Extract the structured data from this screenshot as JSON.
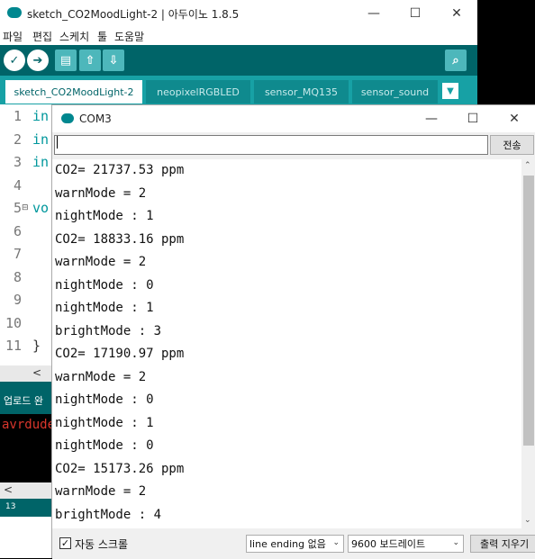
{
  "ide": {
    "title": "sketch_CO2MoodLight-2 | 아두이노 1.8.5",
    "window_controls": {
      "minimize": "—",
      "maximize": "☐",
      "close": "✕"
    },
    "menu": [
      "파일",
      "편집",
      "스케치",
      "툴",
      "도움말"
    ],
    "toolbar_icons": [
      "verify-icon",
      "upload-icon",
      "new-icon",
      "open-icon",
      "save-icon",
      "serial-monitor-icon"
    ],
    "tabs": [
      {
        "label": "sketch_CO2MoodLight-2",
        "active": true
      },
      {
        "label": "neopixelRGBLED",
        "active": false
      },
      {
        "label": "sensor_MQ135",
        "active": false
      },
      {
        "label": "sensor_sound",
        "active": false
      }
    ],
    "tab_menu": "▼",
    "line_numbers": [
      "1",
      "2",
      "3",
      "4",
      "5",
      "6",
      "7",
      "8",
      "9",
      "10",
      "11"
    ],
    "code_lines": [
      "in",
      "in",
      "in",
      "",
      "vo",
      "}",
      "",
      "}",
      "}",
      "}",
      "}"
    ],
    "status_text": "업로드 완",
    "console_text": "avrdude",
    "bottom_line": "13"
  },
  "serial": {
    "title": "COM3",
    "window_controls": {
      "minimize": "—",
      "maximize": "☐",
      "close": "✕"
    },
    "input_value": "",
    "send_label": "전송",
    "lines": [
      "CO2= 21737.53 ppm",
      "warnMode = 2",
      "nightMode : 1",
      "CO2= 18833.16 ppm",
      "warnMode = 2",
      "nightMode : 0",
      "nightMode : 1",
      "brightMode : 3",
      "CO2= 17190.97 ppm",
      "warnMode = 2",
      "nightMode : 0",
      "nightMode : 1",
      "nightMode : 0",
      "CO2= 15173.26 ppm",
      "warnMode = 2",
      "brightMode : 4"
    ],
    "autoscroll_checked": true,
    "autoscroll_label": "자동 스크롤",
    "line_ending": "line ending 없음",
    "baud": "9600 보드레이트",
    "clear_label": "출력 지우기"
  },
  "colors": {
    "ide_dark_teal": "#006468",
    "ide_tab_teal": "#17a1a5",
    "code_teal": "#00979c",
    "console_red": "#d9362c"
  }
}
